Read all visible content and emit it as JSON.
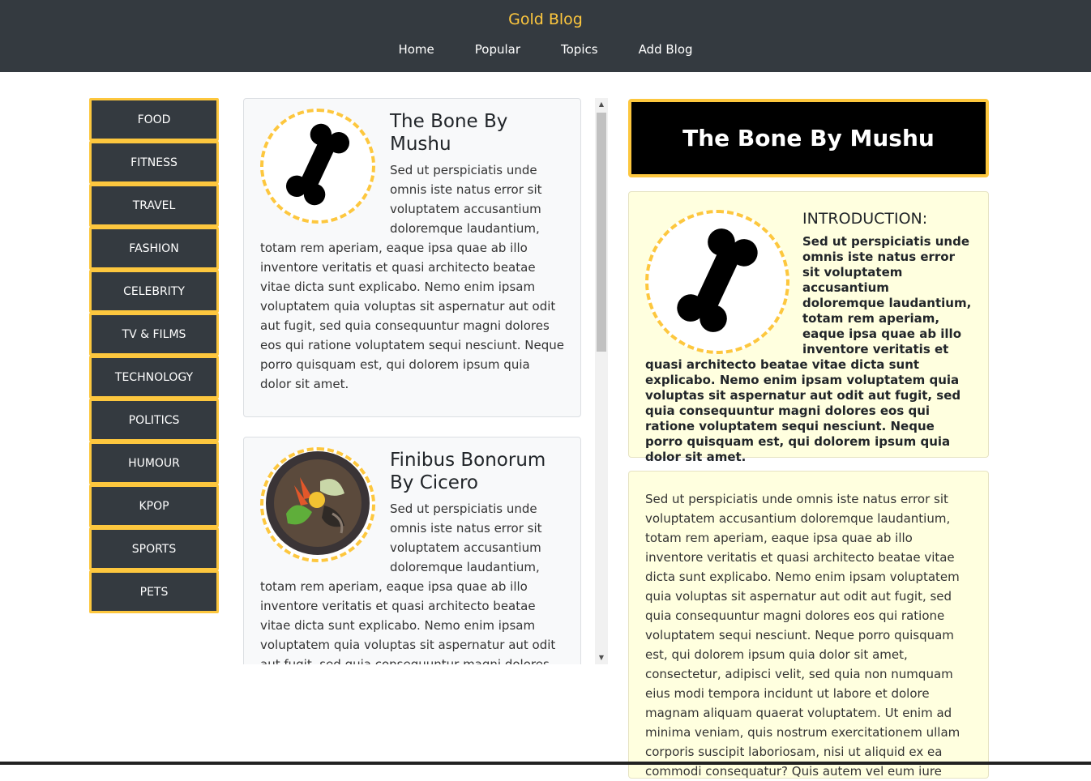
{
  "header": {
    "brand": "Gold Blog",
    "nav": [
      "Home",
      "Popular",
      "Topics",
      "Add Blog"
    ]
  },
  "sidebar": {
    "categories": [
      "FOOD",
      "FITNESS",
      "TRAVEL",
      "FASHION",
      "CELEBRITY",
      "TV & FILMS",
      "TECHNOLOGY",
      "POLITICS",
      "HUMOUR",
      "KPOP",
      "SPORTS",
      "PETS"
    ]
  },
  "feed": {
    "posts": [
      {
        "title": "The Bone By Mushu",
        "image_icon": "bone-icon",
        "text": "Sed ut perspiciatis unde omnis iste natus error sit voluptatem accusantium doloremque laudantium, totam rem aperiam, eaque ipsa quae ab illo inventore veritatis et quasi architecto beatae vitae dicta sunt explicabo. Nemo enim ipsam voluptatem quia voluptas sit aspernatur aut odit aut fugit, sed quia consequuntur magni dolores eos qui ratione voluptatem sequi nesciunt. Neque porro quisquam est, qui dolorem ipsum quia dolor sit amet."
      },
      {
        "title": "Finibus Bonorum By Cicero",
        "image_icon": "food-bowl-icon",
        "text": "Sed ut perspiciatis unde omnis iste natus error sit voluptatem accusantium doloremque laudantium, totam rem aperiam, eaque ipsa quae ab illo inventore veritatis et quasi architecto beatae vitae dicta sunt explicabo. Nemo enim ipsam voluptatem quia voluptas sit aspernatur aut odit aut fugit, sed quia consequuntur magni dolores eos qui ratione voluptatem sequi nesciunt. Neque porro quisquam"
      }
    ]
  },
  "detail": {
    "title": "The Bone By Mushu",
    "intro_heading": "INTRODUCTION:",
    "intro_text": "Sed ut perspiciatis unde omnis iste natus error sit voluptatem accusantium doloremque laudantium, totam rem aperiam, eaque ipsa quae ab illo inventore veritatis et quasi architecto beatae vitae dicta sunt explicabo. Nemo enim ipsam voluptatem quia voluptas sit aspernatur aut odit aut fugit, sed quia consequuntur magni dolores eos qui ratione voluptatem sequi nesciunt. Neque porro quisquam est, qui dolorem ipsum quia dolor sit amet.",
    "body_text": "Sed ut perspiciatis unde omnis iste natus error sit voluptatem accusantium doloremque laudantium, totam rem aperiam, eaque ipsa quae ab illo inventore veritatis et quasi architecto beatae vitae dicta sunt explicabo. Nemo enim ipsam voluptatem quia voluptas sit aspernatur aut odit aut fugit, sed quia consequuntur magni dolores eos qui ratione voluptatem sequi nesciunt. Neque porro quisquam est, qui dolorem ipsum quia dolor sit amet, consectetur, adipisci velit, sed quia non numquam eius modi tempora incidunt ut labore et dolore magnam aliquam quaerat voluptatem. Ut enim ad minima veniam, quis nostrum exercitationem ullam corporis suscipit laboriosam, nisi ut aliquid ex ea commodi consequatur? Quis autem vel eum iure"
  },
  "colors": {
    "accent": "#fdc73e",
    "header_bg": "#343a40",
    "card_bg": "#f8f9fa",
    "detail_bg": "#ffffdf"
  }
}
